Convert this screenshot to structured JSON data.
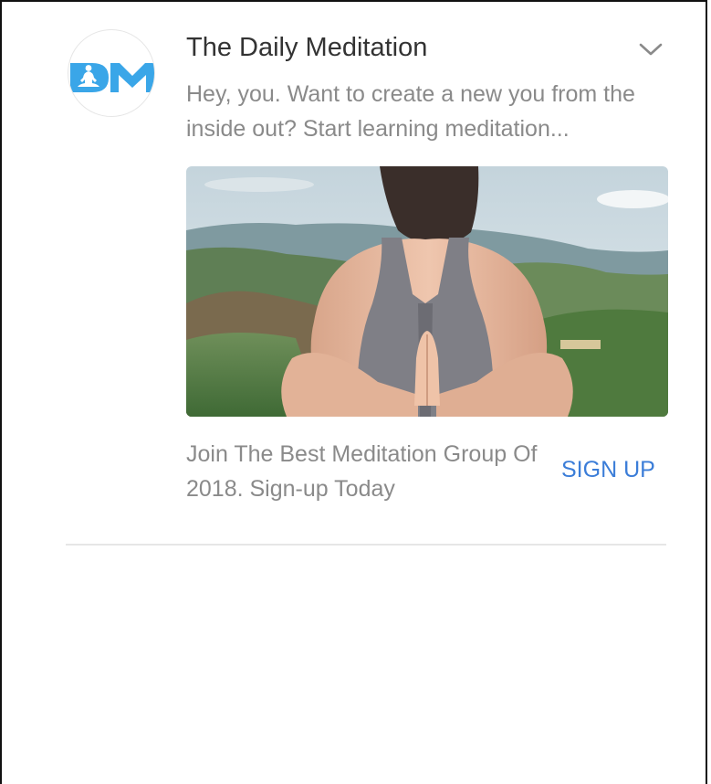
{
  "ad": {
    "advertiser_name": "The Daily Meditation",
    "logo_text": "DM",
    "body_text": "Hey, you. Want to create a new you from the inside out? Start learning meditation...",
    "headline": "Join The Best Meditation Group Of 2018. Sign-up Today",
    "cta_label": "SIGN UP",
    "menu_icon": "chevron-down-icon",
    "logo_icon": "meditation-logo-icon"
  },
  "colors": {
    "brand_blue": "#3aa6e8",
    "cta_blue": "#3b7dd8",
    "title_text": "#333333",
    "muted_text": "#8a8a8a",
    "divider": "#e6e6e6"
  }
}
